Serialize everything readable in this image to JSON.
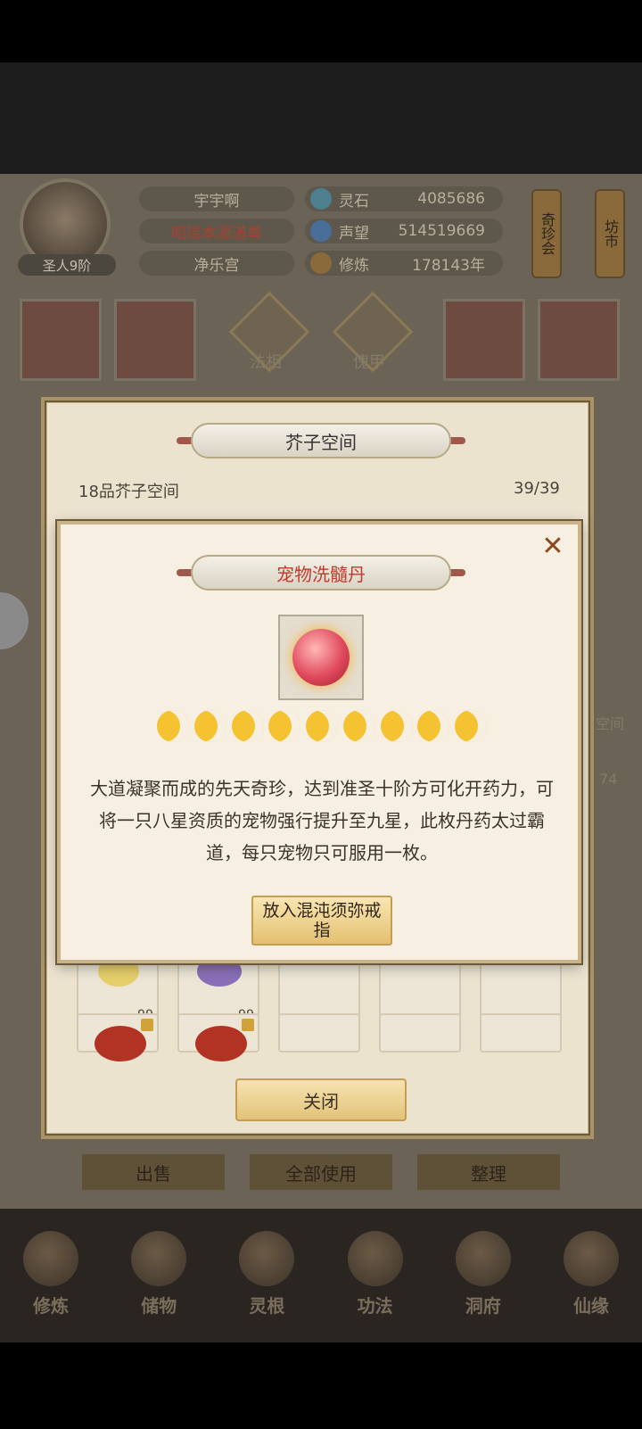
{
  "player": {
    "name": "宇宇啊",
    "title": "昭瑶本源道尊",
    "sect": "净乐宫",
    "rank": "圣人9阶"
  },
  "resources": [
    {
      "label": "灵石",
      "value": "4085686",
      "icon": "spirit-stone-icon"
    },
    {
      "label": "声望",
      "value": "514519669",
      "icon": "prestige-icon"
    },
    {
      "label": "修炼",
      "value": "178143年",
      "icon": "cultivation-icon"
    }
  ],
  "side_buttons": {
    "treasure_fair": "奇珍会",
    "market": "坊市"
  },
  "equipment": {
    "dharma_form": "法相",
    "armor": "傀甲"
  },
  "background_labels": {
    "space_side": "空间",
    "side_count": "74"
  },
  "storage_dialog": {
    "title": "芥子空间",
    "space_name": "18品芥子空间",
    "capacity": "39/39",
    "slots_row1": [
      {
        "count": "99"
      },
      {
        "count": "99"
      },
      {
        "count": ""
      },
      {
        "count": ""
      },
      {
        "count": ""
      }
    ],
    "close_label": "关闭"
  },
  "item_dialog": {
    "title": "宠物洗髓丹",
    "star_count": 9,
    "description": "大道凝聚而成的先天奇珍，达到准圣十阶方可化开药力，可将一只八星资质的宠物强行提升至九星，此枚丹药太过霸道，每只宠物只可服用一枚。",
    "action_label": "放入混沌须弥戒指"
  },
  "bottom_buttons": {
    "sell": "出售",
    "use_all": "全部使用",
    "sort": "整理"
  },
  "nav": [
    {
      "label": "修炼",
      "icon": "cultivation-nav-icon"
    },
    {
      "label": "储物",
      "icon": "storage-bag-icon"
    },
    {
      "label": "灵根",
      "icon": "spirit-root-icon"
    },
    {
      "label": "功法",
      "icon": "technique-book-icon"
    },
    {
      "label": "洞府",
      "icon": "cave-dwelling-icon"
    },
    {
      "label": "仙缘",
      "icon": "immortal-fate-icon"
    }
  ],
  "colors": {
    "accent_red": "#c0392b",
    "gold": "#f5c232",
    "panel": "#f7f0e2"
  }
}
